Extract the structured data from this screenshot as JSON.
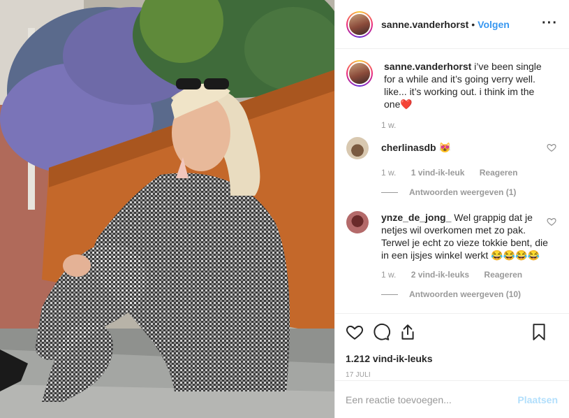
{
  "post": {
    "username": "sanne.vanderhorst",
    "follow_label": "Volgen",
    "caption_text": "i’ve been single for a while and it’s going verry well. like... it’s working out. i think im the one",
    "caption_emoji": "❤️",
    "caption_age": "1 w.",
    "likes": "1.212 vind-ik-leuks",
    "date": "17 JULI",
    "photo_icon": "photo-of-woman-in-gingham-suit"
  },
  "comments": [
    {
      "username": "cherlinasdb",
      "text": "😻",
      "age": "1 w.",
      "likes": "1 vind-ik-leuk",
      "reply_label": "Reageren",
      "view_replies": "Antwoorden weergeven (1)"
    },
    {
      "username": "ynze_de_jong_",
      "text": "Wel grappig dat je netjes wil overkomen met zo pak. Terwel je echt zo vieze tokkie bent, die in een ijsjes winkel werkt 😂😂😂😂",
      "age": "1 w.",
      "likes": "2 vind-ik-leuks",
      "reply_label": "Reageren",
      "view_replies": "Antwoorden weergeven (10)"
    }
  ],
  "composer": {
    "placeholder": "Een reactie toevoegen...",
    "submit_label": "Plaatsen"
  },
  "colors": {
    "accent": "#3897f0",
    "muted": "#999999",
    "disabled_post": "#b2dffc"
  }
}
